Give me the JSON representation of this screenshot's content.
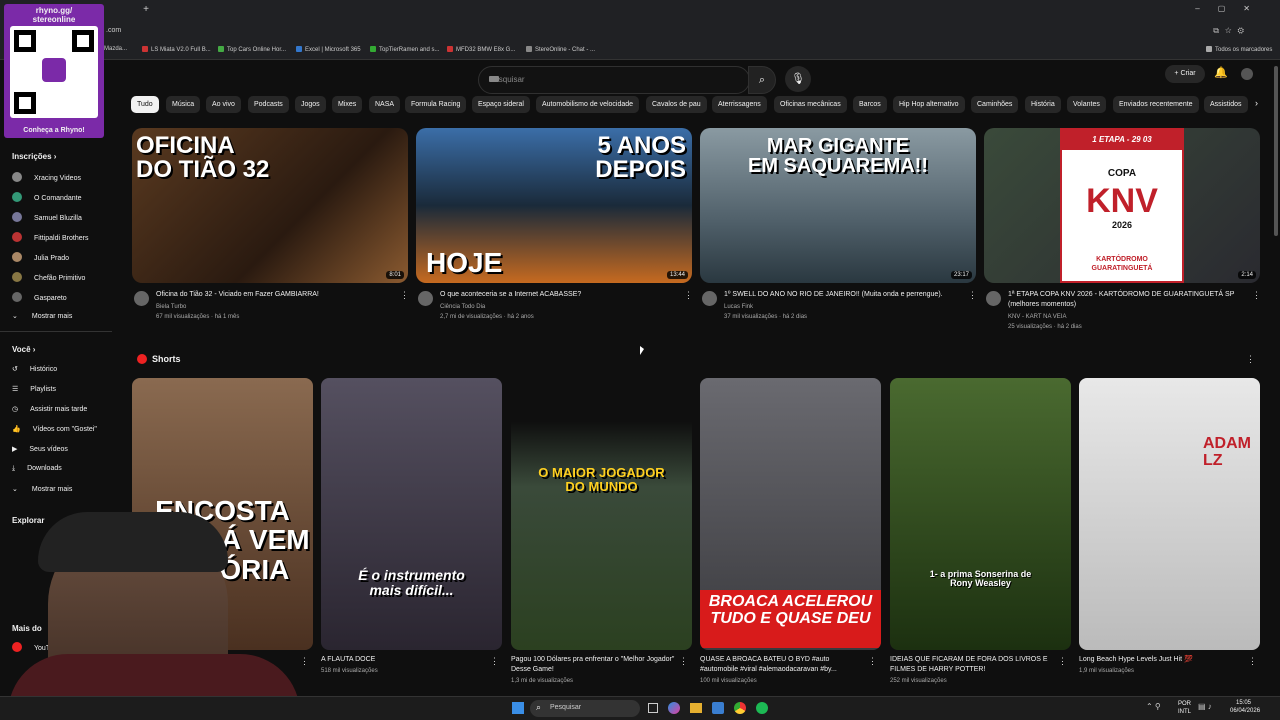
{
  "browser": {
    "address": ".com",
    "bookmarks": [
      "Mazda...",
      "LS Miata V2.0 Full B...",
      "Top Cars Online Hor...",
      "Excel | Microsoft 365",
      "TopTierRamen and s...",
      "MFD32 BMW E8x G...",
      "StereOnline - Chat - ..."
    ],
    "all_bookmarks": "Todos os marcadores"
  },
  "overlay": {
    "title": "rhyno.gg/\nstereonline",
    "cta": "Conheça a Rhyno!"
  },
  "header": {
    "search_placeholder": "Pesquisar",
    "create": "Criar"
  },
  "chips": [
    "Tudo",
    "Música",
    "Ao vivo",
    "Podcasts",
    "Jogos",
    "Mixes",
    "NASA",
    "Formula Racing",
    "Espaço sideral",
    "Automobilismo de velocidade",
    "Cavalos de pau",
    "Aterrissagens",
    "Oficinas mecânicas",
    "Barcos",
    "Hip Hop alternativo",
    "Caminhões",
    "História",
    "Volantes",
    "Enviados recentemente",
    "Assistidos"
  ],
  "sidebar": {
    "subs_header": "Inscrições",
    "subs": [
      "Xracing Videos",
      "O Comandante",
      "Samuel Bluzilla",
      "Fittipaldi Brothers",
      "Julia Prado",
      "Chefão Primitivo",
      "Gaspareto"
    ],
    "show_more": "Mostrar mais",
    "you_header": "Você",
    "you": [
      "Histórico",
      "Playlists",
      "Assistir mais tarde",
      "Vídeos com \"Gostei\"",
      "Seus vídeos",
      "Downloads"
    ],
    "show_more2": "Mostrar mais",
    "explore_header": "Explorar",
    "more_header": "Mais do",
    "more_item": "YouT"
  },
  "videos": [
    {
      "title": "Oficina do Tião 32 - Viciado em Fazer GAMBIARRA!",
      "channel": "Biela Turbo",
      "meta": "67 mil visualizações · há 1 mês",
      "duration": "8:01",
      "thumb_text": [
        "OFICINA",
        "DO TIÃO 32"
      ],
      "accent": "#e0902a"
    },
    {
      "title": "O que aconteceria se a Internet ACABASSE?",
      "channel": "Ciência Todo Dia",
      "meta": "2,7 mi de visualizações · há 2 anos",
      "duration": "13:44",
      "thumb_text": [
        "5 ANOS",
        "DEPOIS",
        "HOJE"
      ],
      "accent": "#3b6ea8"
    },
    {
      "title": "1º SWELL DO ANO NO RIO DE JANEIRO!! (Muita onda e perrengue).",
      "channel": "Lucas Fink",
      "meta": "37 mil visualizações · há 2 dias",
      "duration": "23:17",
      "thumb_text": [
        "MAR GIGANTE",
        "EM SAQUAREMA!!"
      ],
      "accent": "#7a8a92"
    },
    {
      "title": "1ª ETAPA COPA KNV 2026 - KARTÓDROMO DE GUARATINGUETÁ SP (melhores momentos)",
      "channel": "KNV - KART NA VEIA",
      "meta": "25 visualizações · há 2 dias",
      "duration": "2:14",
      "thumb_text": [
        "1 ETAPA - 29 03",
        "COPA",
        "KNV",
        "2026",
        "KARTÓDROMO GUARATINGUETÁ"
      ],
      "accent": "#c0202a"
    }
  ],
  "shorts_header": "Shorts",
  "shorts": [
    {
      "title": "",
      "views": "",
      "caption": "ENCOSTA\nQUE LÁ VEM\nHISTÓRIA",
      "bg": "#6b5040"
    },
    {
      "title": "A FLAUTA DOCE",
      "views": "518 mil visualizações",
      "caption": "É o instrumento\nmais difícil...",
      "bg": "#3a3540"
    },
    {
      "title": "Pagou 100 Dólares pra enfrentar o \"Melhor Jogador\" Desse Game!",
      "views": "1,3 mi de visualizações",
      "caption": "O MAIOR JOGADOR\nDO MUNDO",
      "bg": "#2b4020"
    },
    {
      "title": "QUASE A BROACA BATEU O BYD #auto #automobile #viral #alemaodacaravan #by...",
      "views": "100 mil visualizações",
      "caption": "BROACA ACELEROU\nTUDO E QUASE DEU",
      "bg": "#404448"
    },
    {
      "title": "IDEIAS QUE FICARAM DE FORA DOS LIVROS E FILMES DE HARRY POTTER!",
      "views": "252 mil visualizações",
      "caption": "1- a prima Sonserina de\nRony Weasley",
      "bg": "#2c4a20"
    },
    {
      "title": "Long Beach Hype Levels Just Hit 💯",
      "views": "1,9 mil visualizações",
      "caption": "ADAM\nLZ",
      "bg": "#d8d8d8"
    }
  ],
  "taskbar": {
    "search": "Pesquisar",
    "lang": "POR\nINTL",
    "time": "15:05",
    "date": "06/04/2026"
  }
}
